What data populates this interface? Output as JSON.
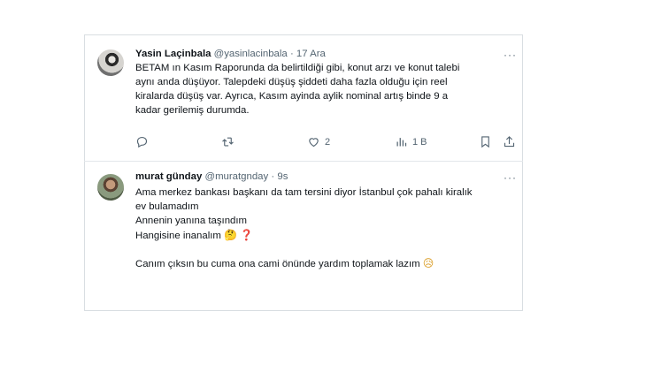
{
  "tweets": [
    {
      "name": "Yasin Laçinbala",
      "handle": "@yasinlacinbala",
      "sep": "·",
      "time": "17 Ara",
      "more": "···",
      "lines": [
        "BETAM ın Kasım Raporunda da belirtildiği gibi, konut arzı ve konut talebi",
        "aynı anda düşüyor. Talepdeki düşüş şiddeti daha fazla olduğu için reel",
        "kiralarda düşüş var. Ayrıca, Kasım ayinda  aylik nominal artış binde 9 a",
        "kadar gerilemiş durumda."
      ],
      "stats": {
        "likes": "2",
        "views": "1 B"
      }
    },
    {
      "name": "murat günday",
      "handle": "@muratgnday",
      "sep": "·",
      "time": "9s",
      "more": "···",
      "lines": [
        "Ama merkez bankası başkanı da tam tersini diyor İstanbul çok pahalı kiralık",
        "ev bulamadım",
        "Annenin yanına taşındım",
        "Hangisine inanalım",
        "",
        "Canım çıksın bu cuma ona cami önünde yardım toplamak lazım"
      ],
      "emojis": {
        "thinking": "🤔",
        "question": "❓",
        "sad": "😥"
      }
    }
  ],
  "icons": [
    "reply-icon",
    "retweet-icon",
    "like-icon",
    "views-icon",
    "bookmark-icon",
    "share-icon"
  ]
}
